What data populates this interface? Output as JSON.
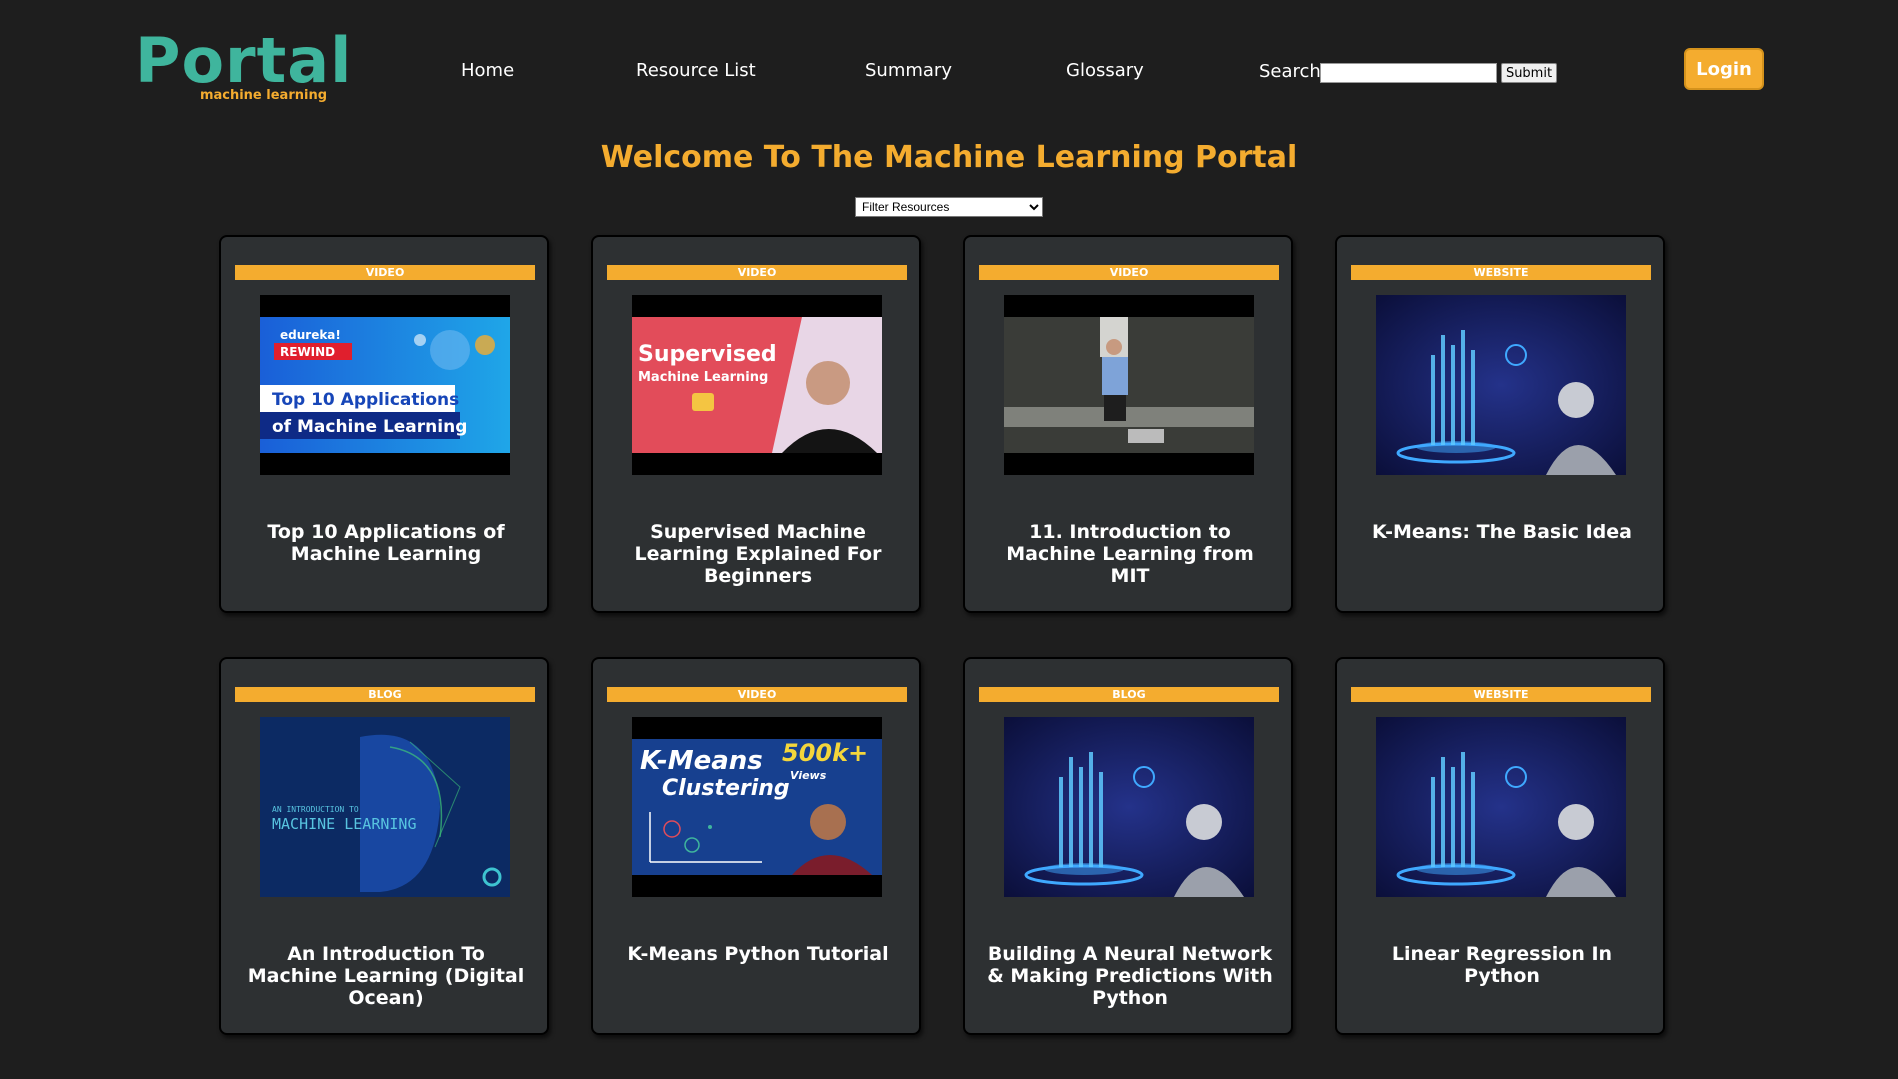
{
  "logo": {
    "main": "Portal",
    "sub": "machine learning"
  },
  "nav": [
    "Home",
    "Resource List",
    "Summary",
    "Glossary"
  ],
  "search": {
    "label": "Search",
    "value": "",
    "submit": "Submit"
  },
  "login": "Login",
  "welcome": "Welcome To The Machine Learning Portal",
  "filter": {
    "selected": "Filter Resources"
  },
  "cards": [
    {
      "type": "VIDEO",
      "title": "Top 10 Applications of Machine Learning",
      "thumb": {
        "brand": "edureka!",
        "tag": "REWIND",
        "line1": "Top 10 Applications",
        "line2": "of Machine Learning"
      }
    },
    {
      "type": "VIDEO",
      "title": "Supervised Machine Learning Explained For Beginners",
      "thumb": {
        "line1": "Supervised",
        "line2": "Machine Learning"
      }
    },
    {
      "type": "VIDEO",
      "title": "11. Introduction to Machine Learning from MIT"
    },
    {
      "type": "WEBSITE",
      "title": "K-Means: The Basic Idea"
    },
    {
      "type": "BLOG",
      "title": "An Introduction To Machine Learning (Digital Ocean)",
      "thumb": {
        "line1": "AN INTRODUCTION TO",
        "line2": "MACHINE LEARNING"
      }
    },
    {
      "type": "VIDEO",
      "title": "K-Means Python Tutorial",
      "thumb": {
        "line1": "K-Means",
        "line2": "Clustering",
        "views": "500k+",
        "views_label": "Views"
      }
    },
    {
      "type": "BLOG",
      "title": "Building A Neural Network & Making Predictions With Python"
    },
    {
      "type": "WEBSITE",
      "title": "Linear Regression In Python"
    }
  ],
  "colors": {
    "accent": "#f4ac2f",
    "logo": "#3fb59d",
    "bg": "#1e1e1e",
    "card": "#2d3032"
  }
}
